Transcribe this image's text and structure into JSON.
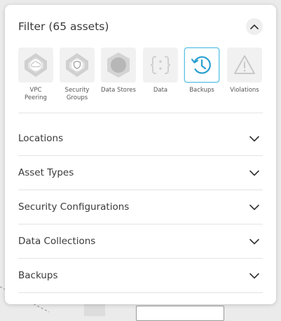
{
  "filter": {
    "title": "Filter (65 assets)"
  },
  "asset_types": [
    {
      "label": "VPC Peering",
      "icon": "vpc-peering-icon",
      "active": false
    },
    {
      "label": "Security Groups",
      "icon": "security-group-icon",
      "active": false
    },
    {
      "label": "Data Stores",
      "icon": "data-store-icon",
      "active": false
    },
    {
      "label": "Data",
      "icon": "data-braces-icon",
      "active": false
    },
    {
      "label": "Backups",
      "icon": "backup-clock-icon",
      "active": true
    },
    {
      "label": "Violations",
      "icon": "violation-warning-icon",
      "active": false
    }
  ],
  "sections": [
    {
      "label": "Locations"
    },
    {
      "label": "Asset Types"
    },
    {
      "label": "Security Configurations"
    },
    {
      "label": "Data Collections"
    },
    {
      "label": "Backups"
    }
  ],
  "colors": {
    "accent": "#2a9fd0",
    "tile_bg": "#f1f1f1",
    "icon_gray": "#bdbdbd"
  }
}
